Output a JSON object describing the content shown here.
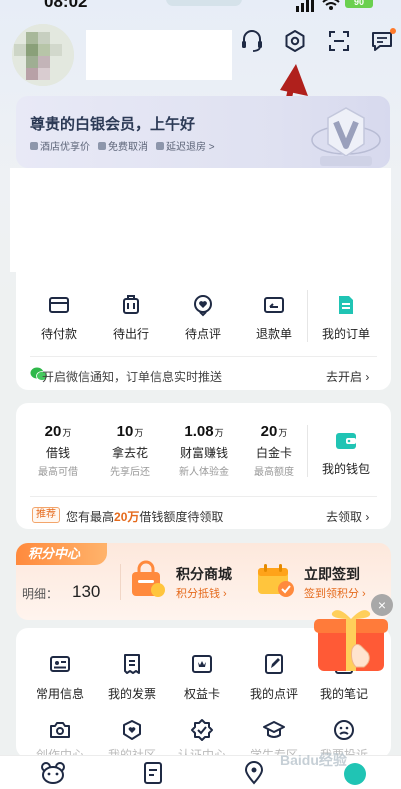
{
  "status_bar": {
    "time": "08:02",
    "battery": "90"
  },
  "vip": {
    "title": "尊贵的白银会员，上午好",
    "perks": [
      "酒店优享价",
      "免费取消",
      "延迟退房 >"
    ]
  },
  "orders": {
    "items": [
      {
        "label": "待付款",
        "icon": "wallet-icon"
      },
      {
        "label": "待出行",
        "icon": "luggage-icon"
      },
      {
        "label": "待点评",
        "icon": "review-icon"
      },
      {
        "label": "退款单",
        "icon": "refund-icon"
      },
      {
        "label": "我的订单",
        "icon": "order-document-icon"
      }
    ],
    "notice_text": "开启微信通知，订单信息实时推送",
    "notice_link": "去开启"
  },
  "wallet": {
    "items": [
      {
        "amount": "20",
        "unit": "万",
        "label": "借钱",
        "sub": "最高可借"
      },
      {
        "amount": "10",
        "unit": "万",
        "label": "拿去花",
        "sub": "先享后还"
      },
      {
        "amount": "1.08",
        "unit": "万",
        "label": "财富赚钱",
        "sub": "新人体验金"
      },
      {
        "amount": "20",
        "unit": "万",
        "label": "白金卡",
        "sub": "最高额度"
      }
    ],
    "my_wallet": "我的钱包",
    "promo_tag": "推荐",
    "promo_prefix": "您有最高",
    "promo_highlight": "20万",
    "promo_suffix": "借钱额度待领取",
    "promo_link": "去领取"
  },
  "points": {
    "tag": "积分中心",
    "detail_label": "明细：",
    "detail_value": "130",
    "mall_title": "积分商城",
    "mall_sub": "积分抵钱",
    "sign_title": "立即签到",
    "sign_sub": "签到领积分"
  },
  "tools": {
    "row1": [
      {
        "label": "常用信息",
        "icon": "id-card-icon"
      },
      {
        "label": "我的发票",
        "icon": "invoice-icon"
      },
      {
        "label": "权益卡",
        "icon": "benefit-card-icon"
      },
      {
        "label": "我的点评",
        "icon": "edit-review-icon"
      },
      {
        "label": "我的笔记",
        "icon": "notes-icon"
      }
    ],
    "row2": [
      {
        "label": "创作中心",
        "icon": "camera-icon"
      },
      {
        "label": "我的社区",
        "icon": "community-icon"
      },
      {
        "label": "认证中心",
        "icon": "verify-badge-icon"
      },
      {
        "label": "学生专区",
        "icon": "graduation-cap-icon"
      },
      {
        "label": "我要投诉",
        "icon": "complaint-icon"
      }
    ]
  },
  "tabbar": {
    "items": [
      {
        "icon": "home-mascot-icon"
      },
      {
        "icon": "itinerary-icon"
      },
      {
        "icon": "location-pin-icon"
      },
      {
        "icon": "my-profile-icon"
      }
    ]
  },
  "watermark": "Baidu经验",
  "colors": {
    "accent": "#e56a1c",
    "primary_icon": "#1f2a44",
    "highlight_icon": "#20c4b4"
  }
}
